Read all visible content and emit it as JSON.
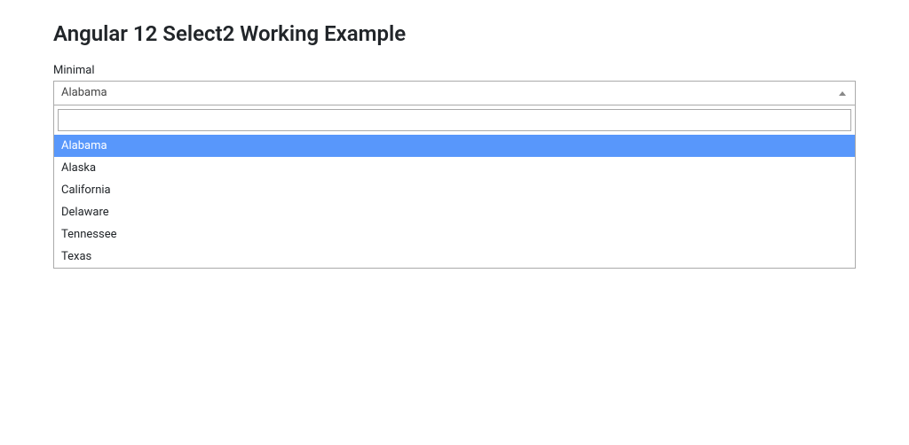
{
  "header": {
    "title": "Angular 12 Select2 Working Example"
  },
  "form": {
    "minimal": {
      "label": "Minimal",
      "selected": "Alabama",
      "search_value": "",
      "options": [
        "Alabama",
        "Alaska",
        "California",
        "Delaware",
        "Tennessee",
        "Texas"
      ],
      "highlighted_index": 0
    }
  }
}
